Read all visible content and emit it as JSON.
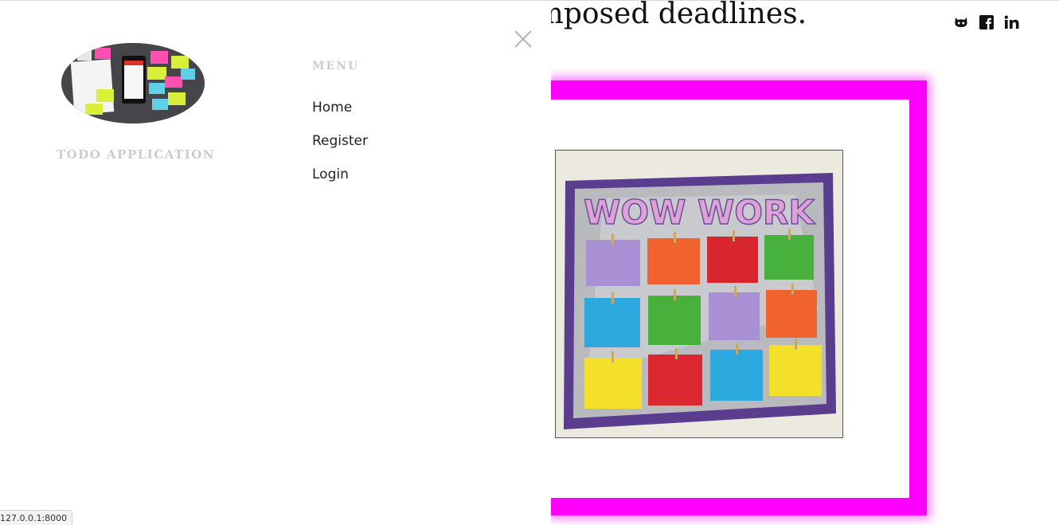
{
  "background": {
    "heading_fragment": "-imposed deadlines.",
    "social_icons": [
      "github-icon",
      "facebook-icon",
      "linkedin-icon"
    ],
    "frame_color": "#ff00ff",
    "photo": {
      "banner_text": "WOW WORK",
      "paper_colors": [
        "#a98fd3",
        "#f0632e",
        "#d7262e",
        "#47b13c",
        "#2da9e0",
        "#47b13c",
        "#a98fd3",
        "#f0632e",
        "#f4e02a",
        "#dd2730",
        "#2da9e0",
        "#f4e02a"
      ]
    }
  },
  "menu": {
    "brand": "TODO APPLICATION",
    "heading": "MENU",
    "items": [
      {
        "label": "Home"
      },
      {
        "label": "Register"
      },
      {
        "label": "Login"
      }
    ],
    "close_icon": "close-icon"
  },
  "status_bar": {
    "url": "127.0.0.1:8000"
  }
}
